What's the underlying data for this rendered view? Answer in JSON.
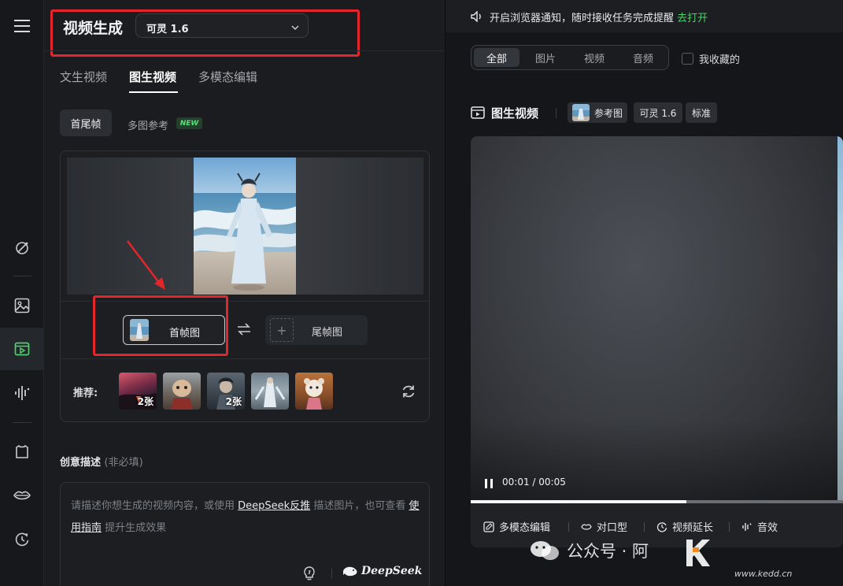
{
  "sidebar": {
    "icons": [
      "menu-icon",
      "magic-wand-icon",
      "image-icon",
      "video-icon",
      "audio-wave-icon",
      "outfit-icon",
      "lips-icon",
      "history-icon"
    ],
    "active": "video-icon"
  },
  "header": {
    "title": "视频生成",
    "model_value": "可灵 1.6"
  },
  "tabs": [
    "文生视频",
    "图生视频",
    "多模态编辑"
  ],
  "active_tab": "图生视频",
  "subtabs": {
    "first_last": "首尾帧",
    "multi_ref": "多图参考",
    "new_badge": "NEW"
  },
  "frames": {
    "first": "首帧图",
    "last": "尾帧图"
  },
  "recommend": {
    "label": "推荐:",
    "items": [
      {
        "count": "2张"
      },
      {
        "count": ""
      },
      {
        "count": "2张"
      },
      {
        "count": ""
      },
      {
        "count": ""
      }
    ]
  },
  "description": {
    "title": "创意描述",
    "optional": "(非必填)",
    "text_1": "请描述你想生成的视频内容，或使用",
    "link_1": "DeepSeek反推",
    "text_2": "描述图片，也可查看",
    "link_2": "使用指南",
    "text_3": "提升生成效果",
    "brand": "DeepSeek"
  },
  "notice": {
    "text": "开启浏览器通知，随时接收任务完成提醒",
    "link": "去打开"
  },
  "filter": {
    "options": [
      "全部",
      "图片",
      "视频",
      "音频"
    ],
    "active": "全部",
    "favorites": "我收藏的"
  },
  "result": {
    "title": "图生视频",
    "tags": [
      "参考图",
      "可灵 1.6",
      "标准"
    ],
    "time": "00:01 / 00:05",
    "progress": 0.58,
    "tools": [
      "多模态编辑",
      "对口型",
      "视频延长",
      "音效"
    ]
  },
  "watermark": {
    "text": "公众号 · 阿",
    "site": "www.kedd.cn"
  },
  "colors": {
    "accent_green": "#4ed16c",
    "annotation_red": "#e4252b"
  }
}
